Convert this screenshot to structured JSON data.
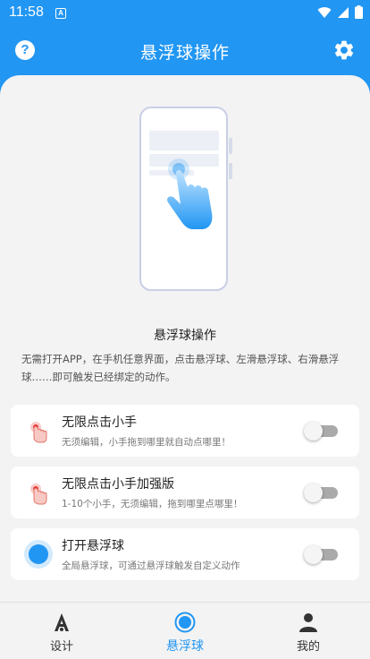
{
  "status_bar": {
    "time": "11:58"
  },
  "app_bar": {
    "title": "悬浮球操作",
    "help_icon": "help-circle-icon",
    "settings_icon": "gear-icon"
  },
  "intro": {
    "headline": "悬浮球操作",
    "description": "无需打开APP，在手机任意界面，点击悬浮球、左滑悬浮球、右滑悬浮球……即可触发已经绑定的动作。"
  },
  "features": [
    {
      "title": "无限点击小手",
      "subtitle": "无须编辑，小手拖到哪里就自动点哪里！",
      "icon": "tap-hand-icon",
      "enabled": false
    },
    {
      "title": "无限点击小手加强版",
      "subtitle": "1-10个小手，无须编辑，拖到哪里点哪里！",
      "icon": "tap-hand-icon",
      "enabled": false
    },
    {
      "title": "打开悬浮球",
      "subtitle": "全局悬浮球，可通过悬浮球触发自定义动作",
      "icon": "floating-ball-icon",
      "enabled": false
    }
  ],
  "bottom_nav": {
    "items": [
      {
        "label": "设计",
        "icon": "design-icon",
        "active": false
      },
      {
        "label": "悬浮球",
        "icon": "floating-ball-icon",
        "active": true
      },
      {
        "label": "我的",
        "icon": "person-icon",
        "active": false
      }
    ]
  },
  "colors": {
    "primary": "#2196f3",
    "background": "#f3f3f3",
    "card": "#ffffff",
    "accent_red": "#e53935"
  }
}
